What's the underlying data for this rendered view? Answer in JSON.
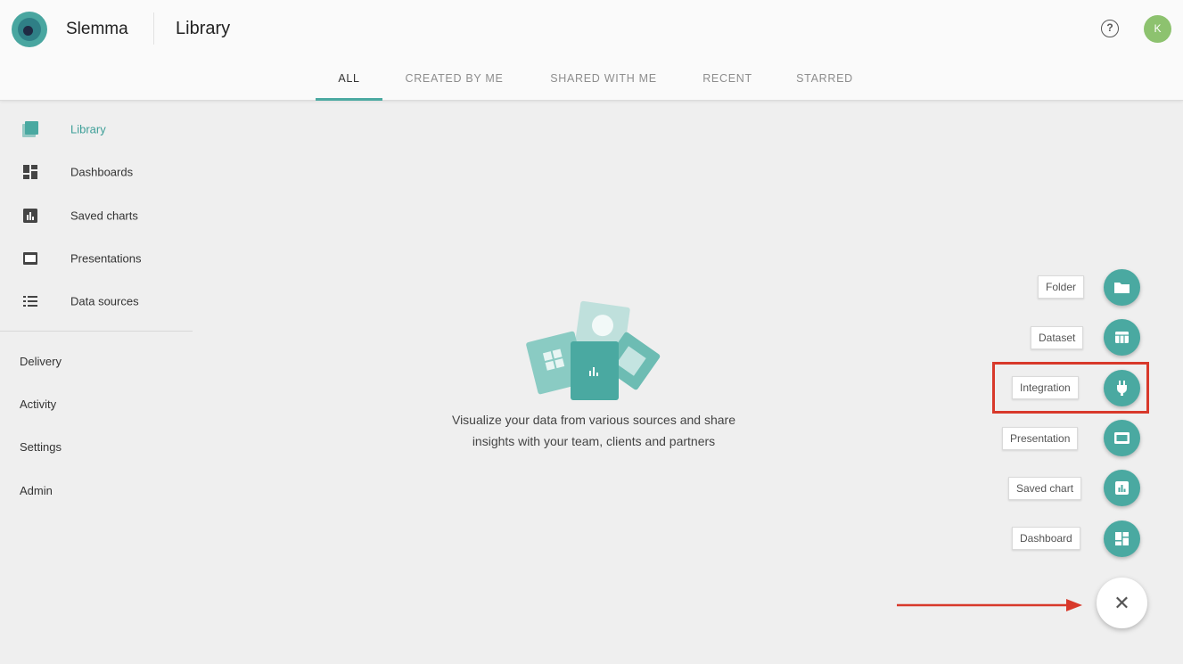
{
  "header": {
    "brand": "Slemma",
    "title": "Library",
    "help_icon": "help-circle-icon",
    "avatar_initial": "K",
    "avatar_color": "#8dc26f"
  },
  "tabs": [
    {
      "label": "ALL",
      "active": true
    },
    {
      "label": "CREATED BY ME",
      "active": false
    },
    {
      "label": "SHARED WITH ME",
      "active": false
    },
    {
      "label": "RECENT",
      "active": false
    },
    {
      "label": "STARRED",
      "active": false
    }
  ],
  "sidebar": {
    "items": [
      {
        "label": "Library",
        "icon": "library-icon",
        "active": true
      },
      {
        "label": "Dashboards",
        "icon": "dashboards-icon",
        "active": false
      },
      {
        "label": "Saved charts",
        "icon": "saved-charts-icon",
        "active": false
      },
      {
        "label": "Presentations",
        "icon": "presentations-icon",
        "active": false
      },
      {
        "label": "Data sources",
        "icon": "data-sources-icon",
        "active": false
      }
    ],
    "secondary": [
      "Delivery",
      "Activity",
      "Settings",
      "Admin"
    ]
  },
  "empty_state": {
    "line1": "Visualize your data from various sources and share",
    "line2": "insights with your team, clients and partners",
    "illustration_icon": "library-illustration-icon"
  },
  "speed_dial": {
    "items": [
      {
        "label": "Folder",
        "icon": "folder-icon"
      },
      {
        "label": "Dataset",
        "icon": "dataset-icon"
      },
      {
        "label": "Integration",
        "icon": "plug-icon",
        "highlighted": true
      },
      {
        "label": "Presentation",
        "icon": "presentation-icon"
      },
      {
        "label": "Saved chart",
        "icon": "chart-icon"
      },
      {
        "label": "Dashboard",
        "icon": "dashboard-icon"
      }
    ],
    "close_glyph": "✕"
  },
  "colors": {
    "accent": "#4aa9a1",
    "annotation": "#d8392b"
  }
}
